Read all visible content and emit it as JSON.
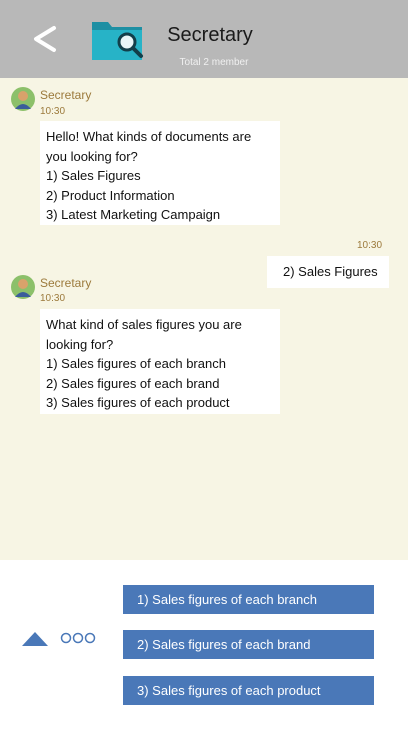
{
  "header": {
    "title": "Secretary",
    "subtitle": "Total 2 member",
    "back_icon": "chevron-left-icon",
    "app_icon": "folder-search-icon",
    "bg_color": "#b8b8b8"
  },
  "chat": {
    "bg_color": "#f7f5e4",
    "messages": [
      {
        "sender": "Secretary",
        "time": "10:30",
        "lines": [
          "Hello! What kinds of documents are",
          "you looking for?",
          "1) Sales Figures",
          "2) Product Information",
          "3) Latest Marketing Campaign"
        ]
      },
      {
        "sender": "user",
        "time": "10:30",
        "text": "2)  Sales Figures"
      },
      {
        "sender": "Secretary",
        "time": "10:30",
        "lines": [
          "What kind of sales figures you are",
          "looking for?",
          "1) Sales figures of each branch",
          "2) Sales figures of each brand",
          "3) Sales figures of each product"
        ]
      }
    ]
  },
  "quick_replies": {
    "accent_color": "#4a78b8",
    "options": [
      "1)  Sales figures of each branch",
      "2)  Sales figures of each brand",
      "3)  Sales figures of each product"
    ],
    "up_icon": "triangle-up-icon",
    "more_icon": "more-dots-icon"
  }
}
